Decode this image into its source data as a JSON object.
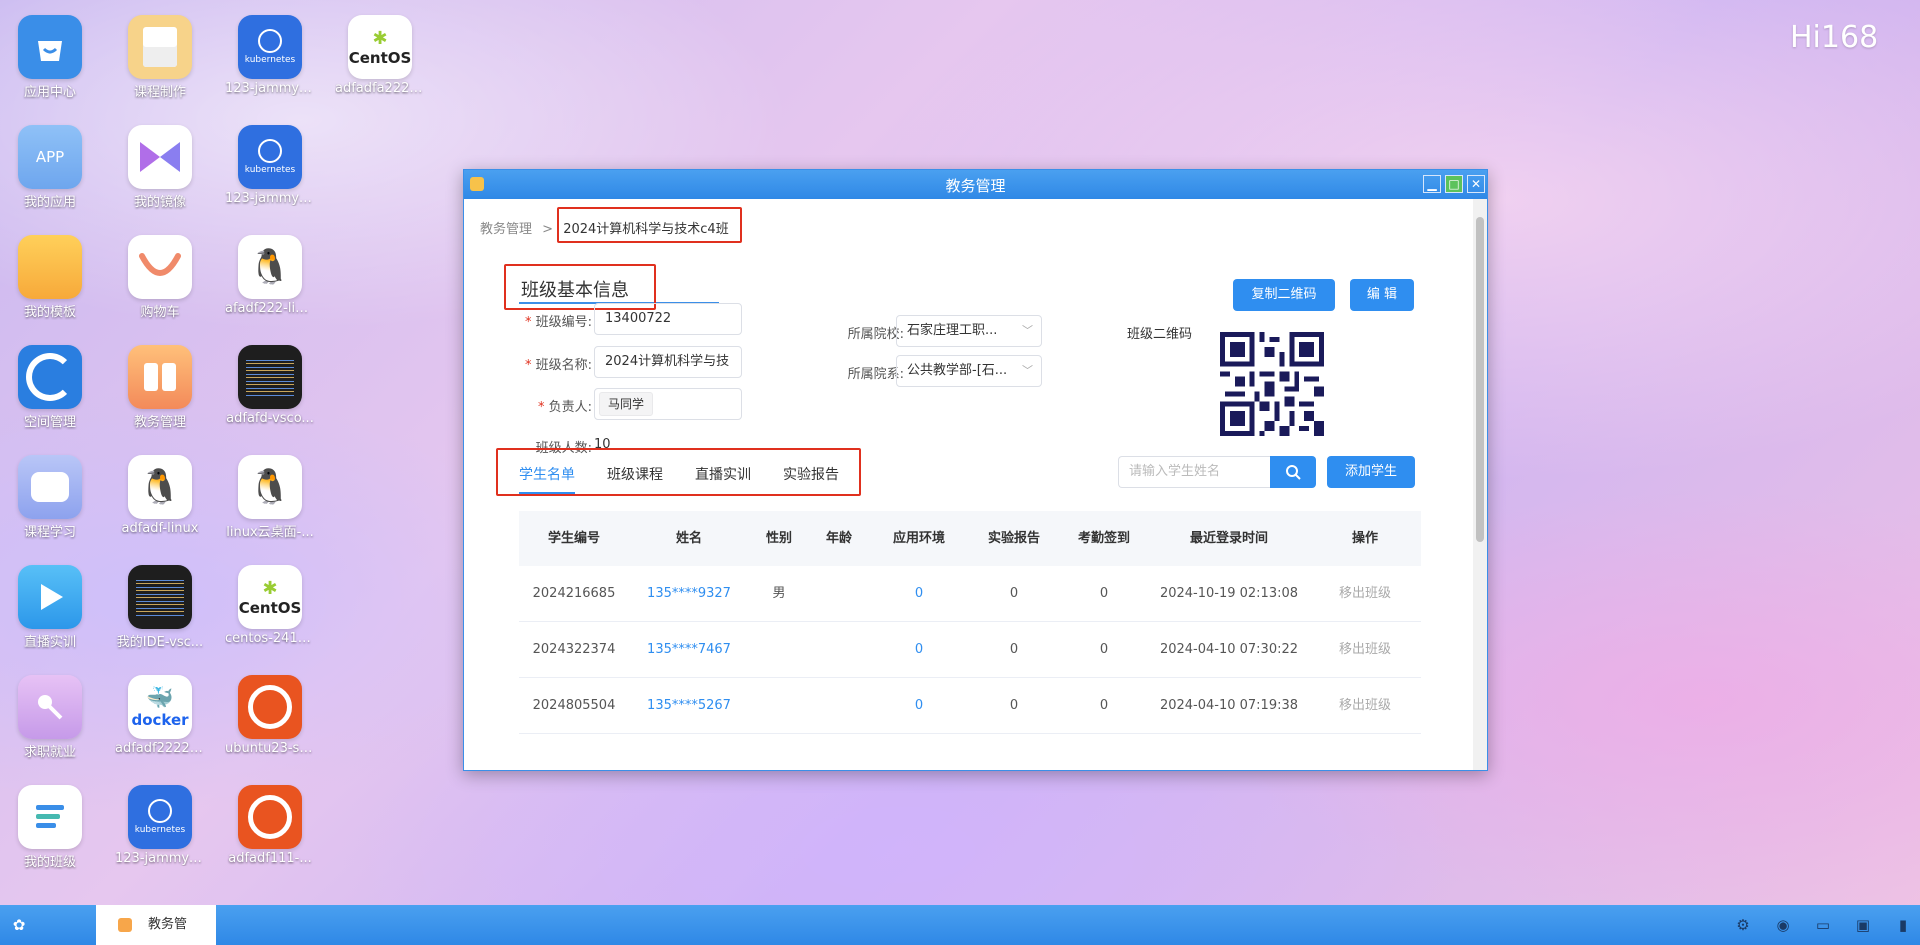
{
  "desktop": {
    "brand": "Hi168",
    "icons": [
      {
        "label": "应用中心"
      },
      {
        "label": "我的应用"
      },
      {
        "label": "我的模板"
      },
      {
        "label": "空间管理"
      },
      {
        "label": "课程学习"
      },
      {
        "label": "直播实训"
      },
      {
        "label": "求职就业"
      },
      {
        "label": "我的班级"
      },
      {
        "label": "课程制作"
      },
      {
        "label": "我的镜像"
      },
      {
        "label": "购物车"
      },
      {
        "label": "教务管理"
      },
      {
        "label": "adfadf-linux"
      },
      {
        "label": "我的IDE-vsc..."
      },
      {
        "label": "adfadf2222-j..."
      },
      {
        "label": "123-jammy-..."
      },
      {
        "label": "123-jammy-..."
      },
      {
        "label": "123-jammy-..."
      },
      {
        "label": "afadf222-linux"
      },
      {
        "label": "adfafd-vsco..."
      },
      {
        "label": "linux云桌面-..."
      },
      {
        "label": "centos-2410..."
      },
      {
        "label": "ubuntu23-se..."
      },
      {
        "label": "adfadf111-..."
      },
      {
        "label": "adfadfa2221..."
      }
    ],
    "icon_text": {
      "k8s": "kubernetes",
      "centos": "CentOS",
      "app": "APP",
      "docker": "docker"
    }
  },
  "window": {
    "title": "教务管理",
    "breadcrumb": {
      "root": "教务管理",
      "sep": ">",
      "current": "2024计算机科学与技术c4班"
    },
    "section_title": "班级基本信息",
    "buttons": {
      "copy_qr": "复制二维码",
      "edit": "编 辑",
      "add_student": "添加学生"
    },
    "form": {
      "class_no_label": "班级编号:",
      "class_no": "13400722",
      "class_name_label": "班级名称:",
      "class_name": "2024计算机科学与技",
      "owner_label": "负责人:",
      "owner": "马同学",
      "count_label": "班级人数:",
      "count": "10",
      "school_label": "所属院校:",
      "school": "石家庄理工职...",
      "dept_label": "所属院系:",
      "dept": "公共教学部-[石...",
      "qr_label": "班级二维码",
      "required_mark": "*"
    },
    "tabs": [
      "学生名单",
      "班级课程",
      "直播实训",
      "实验报告"
    ],
    "search_placeholder": "请输入学生姓名",
    "table": {
      "headers": [
        "学生编号",
        "姓名",
        "性别",
        "年龄",
        "应用环境",
        "实验报告",
        "考勤签到",
        "最近登录时间",
        "操作"
      ],
      "rows": [
        [
          "2024216685",
          "135****9327",
          "男",
          "",
          "0",
          "0",
          "0",
          "2024-10-19 02:13:08",
          "移出班级"
        ],
        [
          "2024322374",
          "135****7467",
          "",
          "",
          "0",
          "0",
          "0",
          "2024-04-10 07:30:22",
          "移出班级"
        ],
        [
          "2024805504",
          "135****5267",
          "",
          "",
          "0",
          "0",
          "0",
          "2024-04-10 07:19:38",
          "移出班级"
        ]
      ]
    }
  },
  "taskbar": {
    "active_task": "教务管"
  },
  "colors": {
    "accent": "#2f8ef0",
    "highlight": "#e0301e",
    "titlebar": "#3b8fe8"
  }
}
